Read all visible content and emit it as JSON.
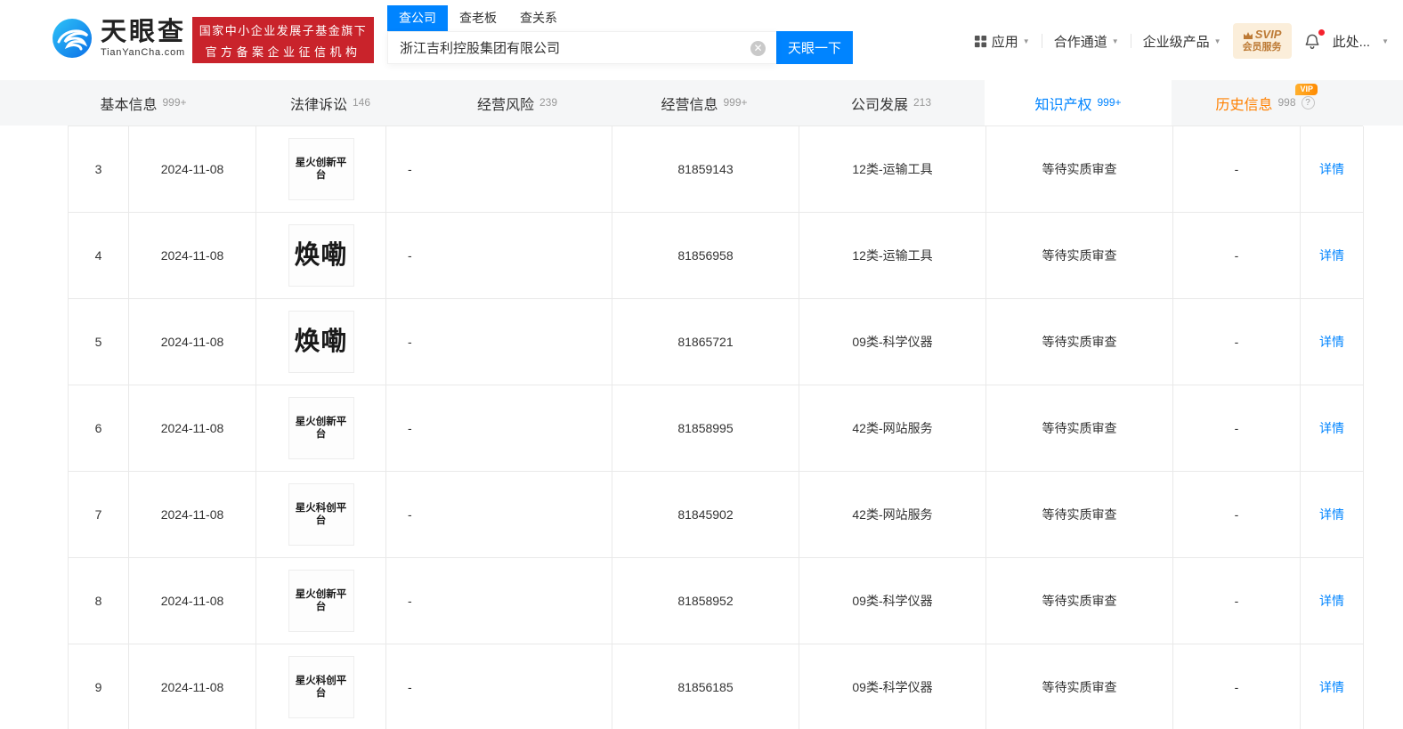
{
  "header": {
    "logo": {
      "brand": "天眼查",
      "domain": "TianYanCha.com"
    },
    "badge": {
      "line1": "国家中小企业发展子基金旗下",
      "line2": "官方备案企业征信机构"
    },
    "search": {
      "tabs": [
        {
          "label": "查公司"
        },
        {
          "label": "查老板"
        },
        {
          "label": "查关系"
        }
      ],
      "value": "浙江吉利控股集团有限公司",
      "button": "天眼一下"
    },
    "nav": {
      "apps": "应用",
      "cooperation": "合作通道",
      "enterprise": "企业级产品",
      "svip_title": "SVIP",
      "svip_sub": "会员服务",
      "more": "此处..."
    }
  },
  "section_tabs": [
    {
      "label": "基本信息",
      "count": "999+"
    },
    {
      "label": "法律诉讼",
      "count": "146"
    },
    {
      "label": "经营风险",
      "count": "239"
    },
    {
      "label": "经营信息",
      "count": "999+"
    },
    {
      "label": "公司发展",
      "count": "213"
    },
    {
      "label": "知识产权",
      "count": "999+"
    },
    {
      "label": "历史信息",
      "count": "998",
      "vip_tag": "VIP",
      "help": "?"
    }
  ],
  "table": {
    "detail_label": "详情",
    "rows": [
      {
        "index": "3",
        "date": "2024-11-08",
        "mark": "星火创新平台",
        "col4": "-",
        "reg_no": "81859143",
        "category": "12类-运输工具",
        "status": "等待实质审查",
        "col8": "-"
      },
      {
        "index": "4",
        "date": "2024-11-08",
        "mark": "焕嘞",
        "col4": "-",
        "reg_no": "81856958",
        "category": "12类-运输工具",
        "status": "等待实质审查",
        "col8": "-"
      },
      {
        "index": "5",
        "date": "2024-11-08",
        "mark": "焕嘞",
        "col4": "-",
        "reg_no": "81865721",
        "category": "09类-科学仪器",
        "status": "等待实质审查",
        "col8": "-"
      },
      {
        "index": "6",
        "date": "2024-11-08",
        "mark": "星火创新平台",
        "col4": "-",
        "reg_no": "81858995",
        "category": "42类-网站服务",
        "status": "等待实质审查",
        "col8": "-"
      },
      {
        "index": "7",
        "date": "2024-11-08",
        "mark": "星火科创平台",
        "col4": "-",
        "reg_no": "81845902",
        "category": "42类-网站服务",
        "status": "等待实质审查",
        "col8": "-"
      },
      {
        "index": "8",
        "date": "2024-11-08",
        "mark": "星火创新平台",
        "col4": "-",
        "reg_no": "81858952",
        "category": "09类-科学仪器",
        "status": "等待实质审查",
        "col8": "-"
      },
      {
        "index": "9",
        "date": "2024-11-08",
        "mark": "星火科创平台",
        "col4": "-",
        "reg_no": "81856185",
        "category": "09类-科学仪器",
        "status": "等待实质审查",
        "col8": "-"
      }
    ]
  },
  "colors": {
    "brand_blue": "#0084ff",
    "badge_red": "#c9232b",
    "history_orange": "#ff8000",
    "link_blue": "#0084ff",
    "svip_text": "#bd7a35",
    "svip_bg": "#fbeeda"
  }
}
